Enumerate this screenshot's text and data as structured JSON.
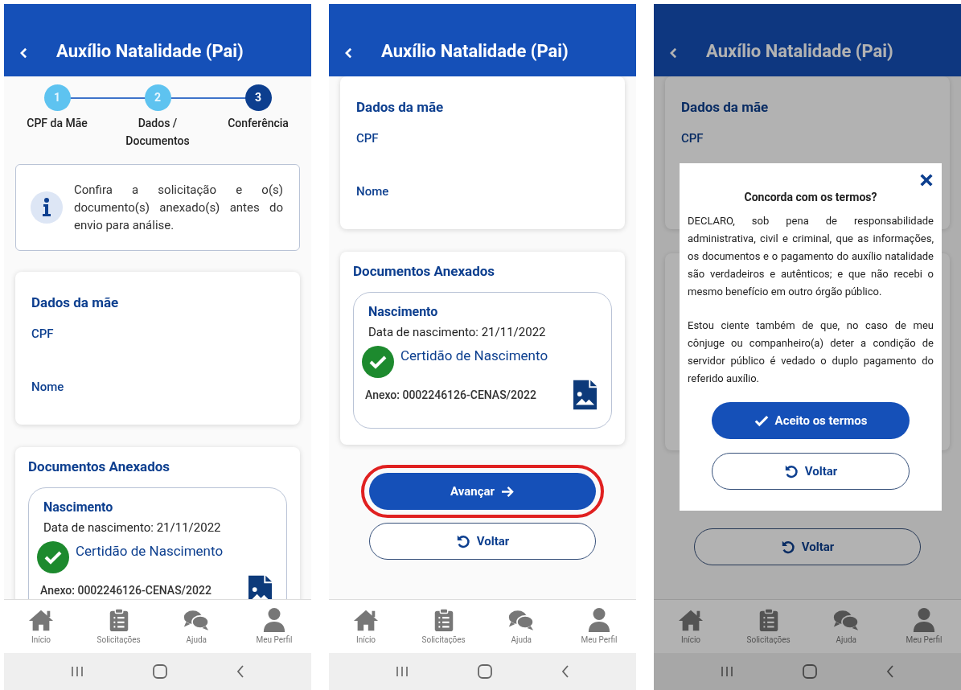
{
  "screens": [
    {
      "header": {
        "title": "Auxílio Natalidade (Pai)"
      },
      "overlay": false,
      "content": [
        {
          "kind": "stepper",
          "steps": [
            {
              "number": "1",
              "label": "CPF da Mãe",
              "selected": false
            },
            {
              "number": "2",
              "label": "Dados / Documentos",
              "selected": false
            },
            {
              "number": "3",
              "label": "Conferência",
              "selected": true
            }
          ]
        },
        {
          "kind": "info",
          "text": "Confira a solicitação e o(s) documento(s) anexado(s) antes do envio para análise."
        },
        {
          "kind": "fields_card",
          "title": "Dados da mãe",
          "fields": [
            "CPF",
            "Nome"
          ]
        },
        {
          "kind": "documents_card",
          "title": "Documentos Anexados",
          "documents": [
            {
              "title": "Nascimento",
              "date": "Data de nascimento: 21/11/2022",
              "file_name": "Certidão de Nascimento",
              "attachment": "Anexo: 0002246126-CENAS/2022"
            }
          ]
        }
      ],
      "bottom_nav": [
        {
          "label": "Início",
          "kind": "home"
        },
        {
          "label": "Solicitações",
          "kind": "requests"
        },
        {
          "label": "Ajuda",
          "kind": "help"
        },
        {
          "label": "Meu Perfil",
          "kind": "profile"
        }
      ]
    },
    {
      "header": {
        "title": "Auxílio Natalidade (Pai)"
      },
      "overlay": false,
      "content": [
        {
          "kind": "fields_card",
          "title": "Dados da mãe",
          "fields": [
            "CPF",
            "Nome"
          ]
        },
        {
          "kind": "documents_card",
          "title": "Documentos Anexados",
          "documents": [
            {
              "title": "Nascimento",
              "date": "Data de nascimento: 21/11/2022",
              "file_name": "Certidão de Nascimento",
              "attachment": "Anexo: 0002246126-CENAS/2022"
            }
          ]
        },
        {
          "kind": "buttons",
          "buttons": [
            {
              "kind": "primary",
              "label": "Avançar",
              "highlighted": true
            },
            {
              "kind": "secondary",
              "label": "Voltar",
              "highlighted": false
            }
          ]
        }
      ],
      "bottom_nav": [
        {
          "label": "Início",
          "kind": "home"
        },
        {
          "label": "Solicitações",
          "kind": "requests"
        },
        {
          "label": "Ajuda",
          "kind": "help"
        },
        {
          "label": "Meu Perfil",
          "kind": "profile"
        }
      ]
    },
    {
      "header": {
        "title": "Auxílio Natalidade (Pai)"
      },
      "overlay": true,
      "content": [
        {
          "kind": "fields_card",
          "title": "Dados da mãe",
          "fields": [
            "CPF"
          ]
        },
        {
          "kind": "blank_card"
        },
        {
          "kind": "buttons",
          "buttons": [
            {
              "kind": "secondary",
              "label": "Voltar",
              "highlighted": false
            }
          ]
        }
      ],
      "dialog": {
        "title": "Concorda com os termos?",
        "paragraphs": [
          "DECLARO, sob pena de responsabilidade administrativa, civil e criminal, que as informações, os documentos e o pagamento do auxílio natalidade são verdadeiros e autênticos; e que não recebi o mesmo benefício em outro órgão público.",
          "Estou ciente também de que, no caso de meu cônjuge ou companheiro(a) deter a condição de servidor público é vedado o duplo pagamento do referido auxílio."
        ],
        "buttons": [
          {
            "kind": "accept",
            "label": "Aceito os termos"
          },
          {
            "kind": "secondary",
            "label": "Voltar"
          }
        ]
      },
      "bottom_nav": [
        {
          "label": "Início",
          "kind": "home"
        },
        {
          "label": "Solicitações",
          "kind": "requests"
        },
        {
          "label": "Ajuda",
          "kind": "help"
        },
        {
          "label": "Meu Perfil",
          "kind": "profile"
        }
      ]
    }
  ]
}
